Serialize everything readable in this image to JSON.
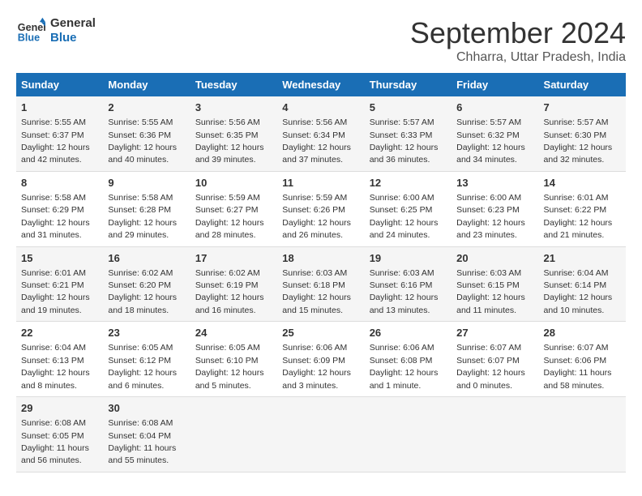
{
  "header": {
    "logo_line1": "General",
    "logo_line2": "Blue",
    "month_title": "September 2024",
    "location": "Chharra, Uttar Pradesh, India"
  },
  "weekdays": [
    "Sunday",
    "Monday",
    "Tuesday",
    "Wednesday",
    "Thursday",
    "Friday",
    "Saturday"
  ],
  "weeks": [
    [
      {
        "day": "1",
        "sunrise": "5:55 AM",
        "sunset": "6:37 PM",
        "daylight": "12 hours and 42 minutes."
      },
      {
        "day": "2",
        "sunrise": "5:55 AM",
        "sunset": "6:36 PM",
        "daylight": "12 hours and 40 minutes."
      },
      {
        "day": "3",
        "sunrise": "5:56 AM",
        "sunset": "6:35 PM",
        "daylight": "12 hours and 39 minutes."
      },
      {
        "day": "4",
        "sunrise": "5:56 AM",
        "sunset": "6:34 PM",
        "daylight": "12 hours and 37 minutes."
      },
      {
        "day": "5",
        "sunrise": "5:57 AM",
        "sunset": "6:33 PM",
        "daylight": "12 hours and 36 minutes."
      },
      {
        "day": "6",
        "sunrise": "5:57 AM",
        "sunset": "6:32 PM",
        "daylight": "12 hours and 34 minutes."
      },
      {
        "day": "7",
        "sunrise": "5:57 AM",
        "sunset": "6:30 PM",
        "daylight": "12 hours and 32 minutes."
      }
    ],
    [
      {
        "day": "8",
        "sunrise": "5:58 AM",
        "sunset": "6:29 PM",
        "daylight": "12 hours and 31 minutes."
      },
      {
        "day": "9",
        "sunrise": "5:58 AM",
        "sunset": "6:28 PM",
        "daylight": "12 hours and 29 minutes."
      },
      {
        "day": "10",
        "sunrise": "5:59 AM",
        "sunset": "6:27 PM",
        "daylight": "12 hours and 28 minutes."
      },
      {
        "day": "11",
        "sunrise": "5:59 AM",
        "sunset": "6:26 PM",
        "daylight": "12 hours and 26 minutes."
      },
      {
        "day": "12",
        "sunrise": "6:00 AM",
        "sunset": "6:25 PM",
        "daylight": "12 hours and 24 minutes."
      },
      {
        "day": "13",
        "sunrise": "6:00 AM",
        "sunset": "6:23 PM",
        "daylight": "12 hours and 23 minutes."
      },
      {
        "day": "14",
        "sunrise": "6:01 AM",
        "sunset": "6:22 PM",
        "daylight": "12 hours and 21 minutes."
      }
    ],
    [
      {
        "day": "15",
        "sunrise": "6:01 AM",
        "sunset": "6:21 PM",
        "daylight": "12 hours and 19 minutes."
      },
      {
        "day": "16",
        "sunrise": "6:02 AM",
        "sunset": "6:20 PM",
        "daylight": "12 hours and 18 minutes."
      },
      {
        "day": "17",
        "sunrise": "6:02 AM",
        "sunset": "6:19 PM",
        "daylight": "12 hours and 16 minutes."
      },
      {
        "day": "18",
        "sunrise": "6:03 AM",
        "sunset": "6:18 PM",
        "daylight": "12 hours and 15 minutes."
      },
      {
        "day": "19",
        "sunrise": "6:03 AM",
        "sunset": "6:16 PM",
        "daylight": "12 hours and 13 minutes."
      },
      {
        "day": "20",
        "sunrise": "6:03 AM",
        "sunset": "6:15 PM",
        "daylight": "12 hours and 11 minutes."
      },
      {
        "day": "21",
        "sunrise": "6:04 AM",
        "sunset": "6:14 PM",
        "daylight": "12 hours and 10 minutes."
      }
    ],
    [
      {
        "day": "22",
        "sunrise": "6:04 AM",
        "sunset": "6:13 PM",
        "daylight": "12 hours and 8 minutes."
      },
      {
        "day": "23",
        "sunrise": "6:05 AM",
        "sunset": "6:12 PM",
        "daylight": "12 hours and 6 minutes."
      },
      {
        "day": "24",
        "sunrise": "6:05 AM",
        "sunset": "6:10 PM",
        "daylight": "12 hours and 5 minutes."
      },
      {
        "day": "25",
        "sunrise": "6:06 AM",
        "sunset": "6:09 PM",
        "daylight": "12 hours and 3 minutes."
      },
      {
        "day": "26",
        "sunrise": "6:06 AM",
        "sunset": "6:08 PM",
        "daylight": "12 hours and 1 minute."
      },
      {
        "day": "27",
        "sunrise": "6:07 AM",
        "sunset": "6:07 PM",
        "daylight": "12 hours and 0 minutes."
      },
      {
        "day": "28",
        "sunrise": "6:07 AM",
        "sunset": "6:06 PM",
        "daylight": "11 hours and 58 minutes."
      }
    ],
    [
      {
        "day": "29",
        "sunrise": "6:08 AM",
        "sunset": "6:05 PM",
        "daylight": "11 hours and 56 minutes."
      },
      {
        "day": "30",
        "sunrise": "6:08 AM",
        "sunset": "6:04 PM",
        "daylight": "11 hours and 55 minutes."
      },
      null,
      null,
      null,
      null,
      null
    ]
  ]
}
